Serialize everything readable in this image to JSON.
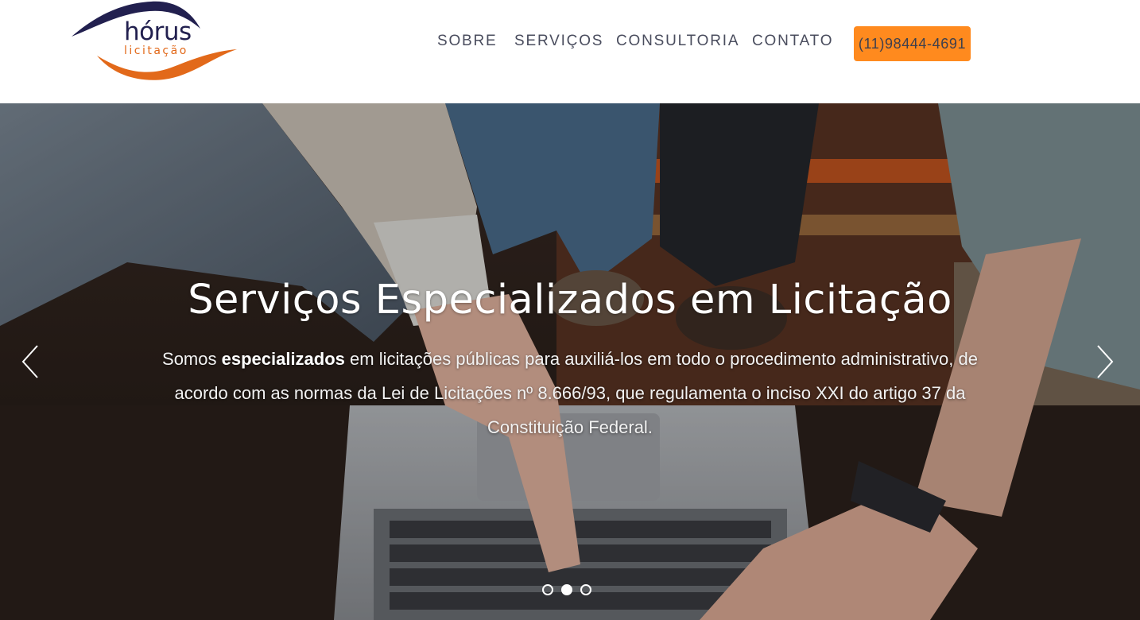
{
  "brand": {
    "name": "hórus",
    "subtitle": "licitação",
    "colors": {
      "navy": "#22204f",
      "orange": "#e2691a"
    }
  },
  "nav": {
    "items": [
      {
        "label": "SOBRE"
      },
      {
        "label": "SERVIÇOS"
      },
      {
        "label": "CONSULTORIA"
      },
      {
        "label": "CONTATO"
      }
    ],
    "phone_button": "(11)98444-4691",
    "accent_color": "#ff8a1e"
  },
  "hero": {
    "title": "Serviços Especializados em Licitação",
    "text_before": "Somos ",
    "text_bold": "especializados",
    "text_after": " em licitações públicas para auxiliá-los em todo o procedimento administrativo, de acordo com as normas da Lei de Licitações nº 8.666/93, que regulamenta o inciso XXI do artigo 37 da Constituição Federal.",
    "prev_icon": "chevron-left-icon",
    "next_icon": "chevron-right-icon",
    "slide_count": 3,
    "active_slide": 2
  }
}
